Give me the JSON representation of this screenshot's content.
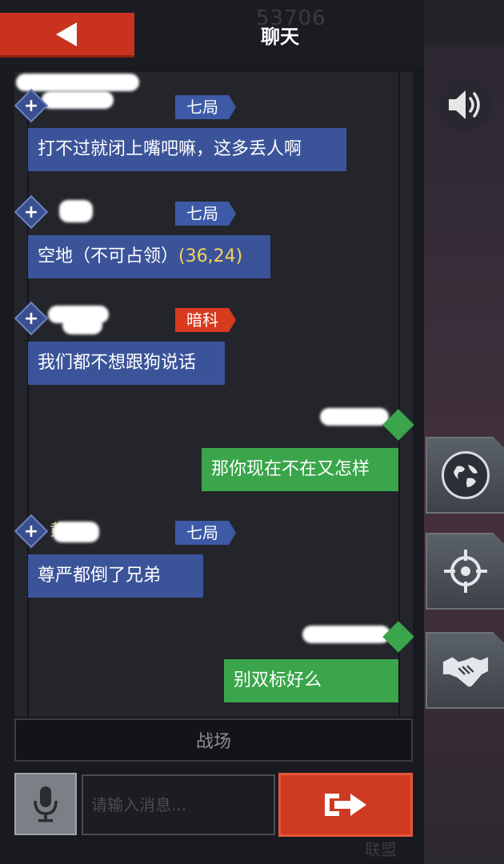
{
  "header": {
    "title": "聊天",
    "ghost_counter": "53706",
    "back_icon": "back-arrow-icon"
  },
  "messages": [
    {
      "side": "left",
      "sender": "",
      "tag": "七局",
      "tag_color": "blue",
      "text": "打不过就闭上嘴吧嘛，这多丢人啊"
    },
    {
      "side": "left",
      "sender": "",
      "tag": "七局",
      "tag_color": "blue",
      "text_prefix": "空地（不可占领）",
      "coord": "(36,24)"
    },
    {
      "side": "left",
      "sender": "",
      "tag": "暗科",
      "tag_color": "red",
      "text": "我们都不想跟狗说话"
    },
    {
      "side": "right",
      "sender": "",
      "text": "那你现在不在又怎样"
    },
    {
      "side": "left",
      "sender": "黄",
      "tag": "七局",
      "tag_color": "blue",
      "text": "尊严都倒了兄弟"
    },
    {
      "side": "right",
      "sender": "",
      "text": "别双标好么"
    }
  ],
  "channel": {
    "label": "战场"
  },
  "input": {
    "placeholder": "请输入消息..."
  },
  "side_buttons": [
    "sound-icon",
    "globe-icon",
    "crosshair-icon",
    "handshake-icon"
  ],
  "bottom_ghost": "联盟",
  "colors": {
    "accent_red": "#cf3b22",
    "bubble_blue": "#3b5499",
    "bubble_green": "#3aa54a",
    "tag_blue": "#3e5aa7",
    "tag_red": "#d83a1f",
    "coord_yellow": "#f4d35e"
  }
}
